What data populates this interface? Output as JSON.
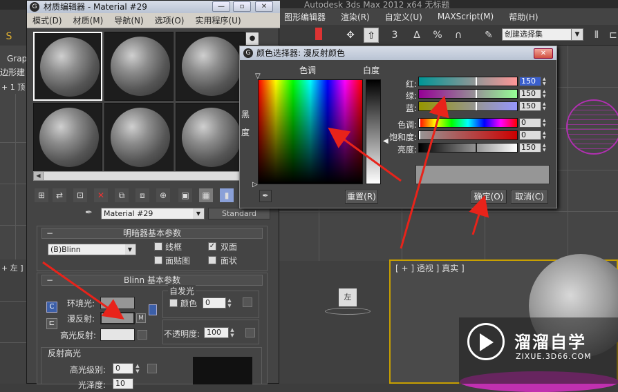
{
  "max": {
    "title": "Autodesk 3ds Max  2012 x64    无标题",
    "menu": [
      "图形编辑器",
      "渲染(R)",
      "自定义(U)",
      "MAXScript(M)",
      "帮助(H)"
    ],
    "selection_set": "创建选择集",
    "left_fragments": [
      "Grap",
      "边形建",
      "+ 1 顶",
      "+ 左 ]"
    ],
    "persp_label": "[ + ] 透视 ] 真实 ]",
    "viewcube_label": "左"
  },
  "material_editor": {
    "title": "材质编辑器 - Material #29",
    "window_buttons": [
      "—",
      "▫",
      "✕"
    ],
    "menu": [
      "模式(D)",
      "材质(M)",
      "导航(N)",
      "选项(O)",
      "实用程序(U)"
    ],
    "material_name": "Material #29",
    "material_type": "Standard",
    "shader_rollout": {
      "title": "明暗器基本参数",
      "shader": "(B)Blinn",
      "wire_label": "线框",
      "two_sided_label": "双面",
      "face_map_label": "面贴图",
      "faceted_label": "面状",
      "two_sided_checked": true
    },
    "blinn_rollout": {
      "title": "Blinn 基本参数",
      "self_illum_title": "自发光",
      "ambient_label": "环境光:",
      "diffuse_label": "漫反射:",
      "specular_label": "高光反射:",
      "color_label": "颜色",
      "color_value": "0",
      "opacity_label": "不透明度:",
      "opacity_value": "100",
      "map_button_label": "M",
      "lock_label": "C"
    },
    "specular_rollout": {
      "title": "反射高光",
      "level_label": "高光级别:",
      "level_value": "0",
      "gloss_label": "光泽度:",
      "gloss_value": "10"
    }
  },
  "color_selector": {
    "title": "颜色选择器: 漫反射颜色",
    "hue_label": "色调",
    "whiteness_label": "白度",
    "black_label_1": "黑",
    "black_label_2": "度",
    "reset_label": "重置(R)",
    "ok_label": "确定(O)",
    "cancel_label": "取消(C)",
    "close_label": "✕",
    "channels": [
      {
        "label": "红:",
        "value": "150"
      },
      {
        "label": "绿:",
        "value": "150"
      },
      {
        "label": "蓝:",
        "value": "150"
      },
      {
        "label": "色调:",
        "value": "0"
      },
      {
        "label": "饱和度:",
        "value": "0"
      },
      {
        "label": "亮度:",
        "value": "150"
      }
    ],
    "current_color": "#969696"
  },
  "watermark": {
    "name": "溜溜自学",
    "url": "ZIXUE.3D66.COM"
  },
  "colors": {
    "annotation_arrow": "#e8231a",
    "persp_border": "#c8a000",
    "selected_field": "#3a5fcd"
  }
}
